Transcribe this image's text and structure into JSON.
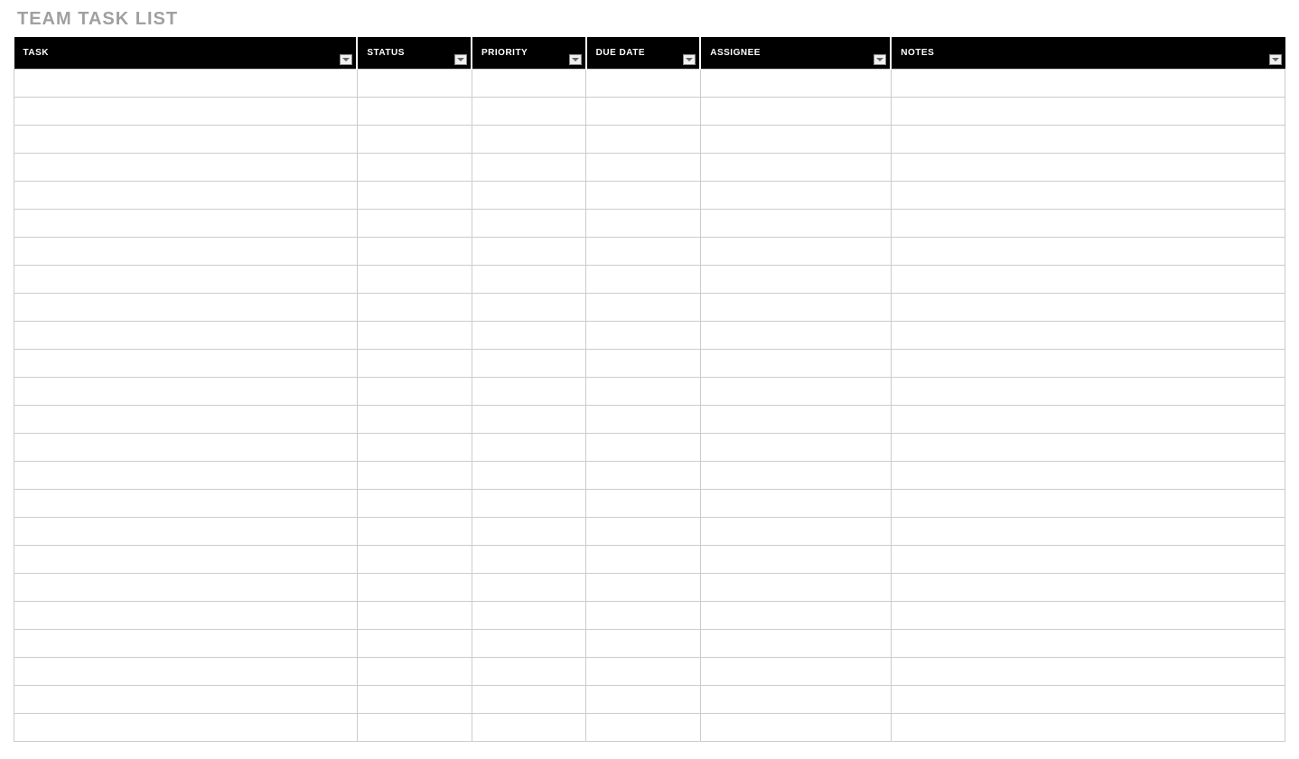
{
  "title": "TEAM TASK LIST",
  "columns": [
    {
      "label": "TASK",
      "filter": true
    },
    {
      "label": "STATUS",
      "filter": true
    },
    {
      "label": "PRIORITY",
      "filter": true
    },
    {
      "label": "DUE DATE",
      "filter": true
    },
    {
      "label": "ASSIGNEE",
      "filter": true
    },
    {
      "label": "NOTES",
      "filter": true
    }
  ],
  "rows": [
    {
      "task": "",
      "status": "",
      "priority": "",
      "duedate": "",
      "assignee": "",
      "notes": ""
    },
    {
      "task": "",
      "status": "",
      "priority": "",
      "duedate": "",
      "assignee": "",
      "notes": ""
    },
    {
      "task": "",
      "status": "",
      "priority": "",
      "duedate": "",
      "assignee": "",
      "notes": ""
    },
    {
      "task": "",
      "status": "",
      "priority": "",
      "duedate": "",
      "assignee": "",
      "notes": ""
    },
    {
      "task": "",
      "status": "",
      "priority": "",
      "duedate": "",
      "assignee": "",
      "notes": ""
    },
    {
      "task": "",
      "status": "",
      "priority": "",
      "duedate": "",
      "assignee": "",
      "notes": ""
    },
    {
      "task": "",
      "status": "",
      "priority": "",
      "duedate": "",
      "assignee": "",
      "notes": ""
    },
    {
      "task": "",
      "status": "",
      "priority": "",
      "duedate": "",
      "assignee": "",
      "notes": ""
    },
    {
      "task": "",
      "status": "",
      "priority": "",
      "duedate": "",
      "assignee": "",
      "notes": ""
    },
    {
      "task": "",
      "status": "",
      "priority": "",
      "duedate": "",
      "assignee": "",
      "notes": ""
    },
    {
      "task": "",
      "status": "",
      "priority": "",
      "duedate": "",
      "assignee": "",
      "notes": ""
    },
    {
      "task": "",
      "status": "",
      "priority": "",
      "duedate": "",
      "assignee": "",
      "notes": ""
    },
    {
      "task": "",
      "status": "",
      "priority": "",
      "duedate": "",
      "assignee": "",
      "notes": ""
    },
    {
      "task": "",
      "status": "",
      "priority": "",
      "duedate": "",
      "assignee": "",
      "notes": ""
    },
    {
      "task": "",
      "status": "",
      "priority": "",
      "duedate": "",
      "assignee": "",
      "notes": ""
    },
    {
      "task": "",
      "status": "",
      "priority": "",
      "duedate": "",
      "assignee": "",
      "notes": ""
    },
    {
      "task": "",
      "status": "",
      "priority": "",
      "duedate": "",
      "assignee": "",
      "notes": ""
    },
    {
      "task": "",
      "status": "",
      "priority": "",
      "duedate": "",
      "assignee": "",
      "notes": ""
    },
    {
      "task": "",
      "status": "",
      "priority": "",
      "duedate": "",
      "assignee": "",
      "notes": ""
    },
    {
      "task": "",
      "status": "",
      "priority": "",
      "duedate": "",
      "assignee": "",
      "notes": ""
    },
    {
      "task": "",
      "status": "",
      "priority": "",
      "duedate": "",
      "assignee": "",
      "notes": ""
    },
    {
      "task": "",
      "status": "",
      "priority": "",
      "duedate": "",
      "assignee": "",
      "notes": ""
    },
    {
      "task": "",
      "status": "",
      "priority": "",
      "duedate": "",
      "assignee": "",
      "notes": ""
    },
    {
      "task": "",
      "status": "",
      "priority": "",
      "duedate": "",
      "assignee": "",
      "notes": ""
    }
  ]
}
